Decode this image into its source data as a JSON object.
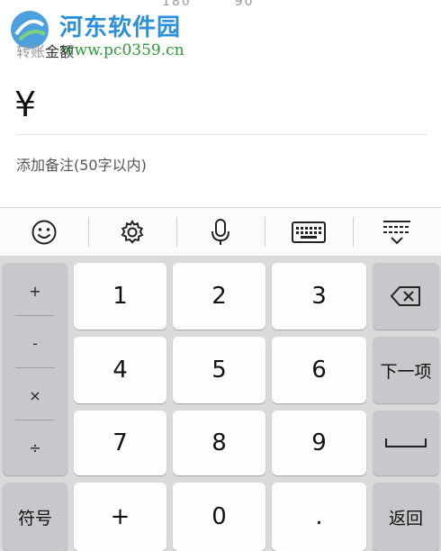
{
  "watermark": {
    "title": "河东软件园",
    "url": "www.pc0359.cn"
  },
  "status_cut": [
    "180",
    "90"
  ],
  "form": {
    "amount_label_covered": "转账",
    "amount_label": "金额",
    "currency": "¥",
    "note_placeholder": "添加备注(50字以内)"
  },
  "toolbar": {
    "items": [
      "emoji-icon",
      "gear-icon",
      "microphone-icon",
      "keyboard-icon",
      "collapse-keyboard-icon"
    ]
  },
  "keyboard": {
    "symbols": [
      "+",
      "-",
      "×",
      "÷"
    ],
    "digits": [
      "1",
      "2",
      "3",
      "4",
      "5",
      "6",
      "7",
      "8",
      "9",
      "0"
    ],
    "fuhao": "符号",
    "plus": "+",
    "dot": ".",
    "backspace_icon": "backspace-icon",
    "next": "下一项",
    "space_icon": "space-icon",
    "back": "返回"
  }
}
